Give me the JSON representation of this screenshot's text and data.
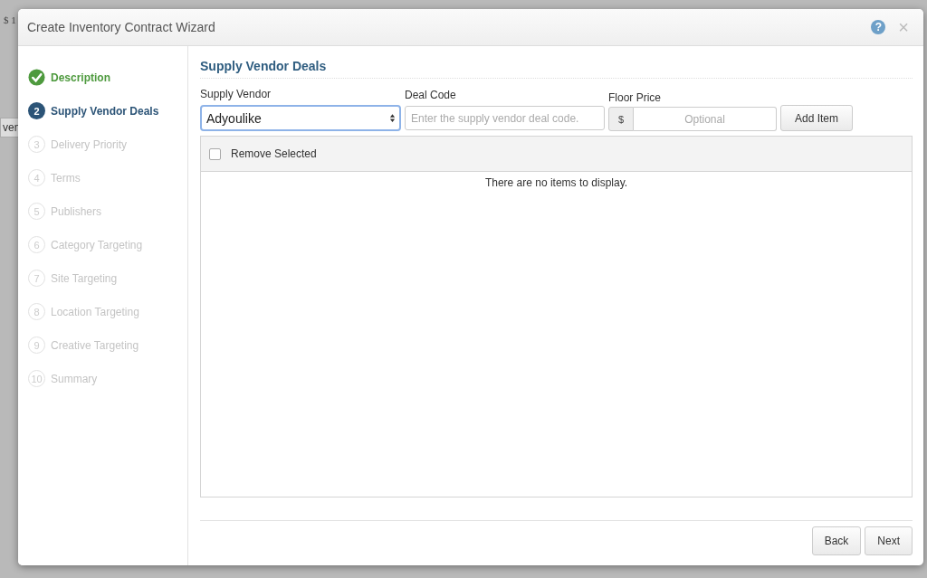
{
  "background": {
    "texts": [
      {
        "text": "$ 1",
        "kind": "price"
      },
      {
        "text": "ven",
        "kind": "tab"
      }
    ]
  },
  "window": {
    "title": "Create Inventory Contract Wizard",
    "help_icon": "?",
    "close_icon": "×"
  },
  "steps": [
    {
      "label": "Description",
      "kind": "done"
    },
    {
      "number": "2",
      "label": "Supply Vendor Deals",
      "kind": "current"
    },
    {
      "number": "3",
      "label": "Delivery Priority",
      "kind": "pending"
    },
    {
      "number": "4",
      "label": "Terms",
      "kind": "pending"
    },
    {
      "number": "5",
      "label": "Publishers",
      "kind": "pending"
    },
    {
      "number": "6",
      "label": "Category Targeting",
      "kind": "pending"
    },
    {
      "number": "7",
      "label": "Site Targeting",
      "kind": "pending"
    },
    {
      "number": "8",
      "label": "Location Targeting",
      "kind": "pending"
    },
    {
      "number": "9",
      "label": "Creative Targeting",
      "kind": "pending"
    },
    {
      "number": "10",
      "label": "Summary",
      "kind": "pending"
    }
  ],
  "section_title": "Supply Vendor Deals",
  "form": {
    "vendor": {
      "label": "Supply Vendor",
      "value": "Adyoulike"
    },
    "deal_code": {
      "label": "Deal Code",
      "placeholder": "Enter the supply vendor deal code."
    },
    "floor_price": {
      "label": "Floor Price",
      "prefix": "$",
      "placeholder": "Optional"
    },
    "add_button": "Add Item"
  },
  "table": {
    "remove_label": "Remove Selected",
    "checked": false,
    "empty_text": "There are no items to display."
  },
  "buttons": [
    "Back",
    "Next"
  ]
}
